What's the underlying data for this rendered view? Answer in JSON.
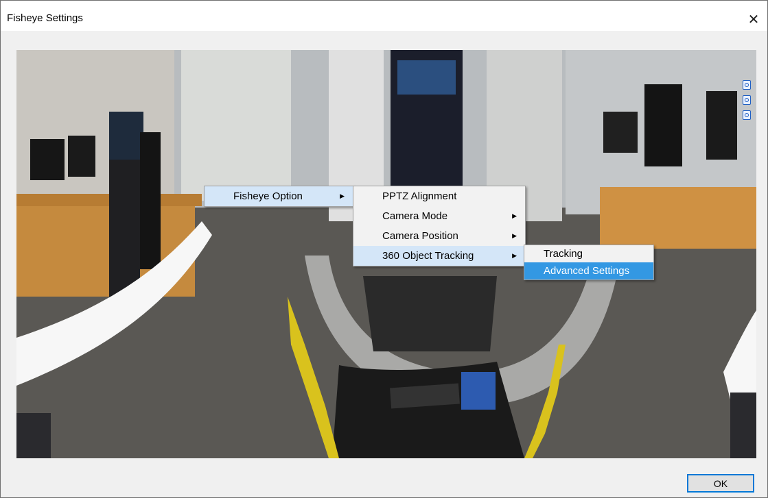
{
  "window": {
    "title": "Fisheye Settings",
    "close_label": "✕"
  },
  "context_menu": {
    "level1": [
      {
        "label": "Fisheye Option",
        "has_submenu": true
      }
    ],
    "level2": [
      {
        "label": "PPTZ Alignment",
        "has_submenu": false
      },
      {
        "label": "Camera Mode",
        "has_submenu": true
      },
      {
        "label": "Camera Position",
        "has_submenu": true
      },
      {
        "label": "360 Object Tracking",
        "has_submenu": true
      }
    ],
    "level3": [
      {
        "label": "Tracking",
        "has_submenu": false
      },
      {
        "label": "Advanced Settings",
        "has_submenu": false
      }
    ],
    "submenu_arrow": "▶"
  },
  "footer": {
    "ok_label": "OK"
  },
  "icons": [
    "close-icon",
    "zoom-in-icon",
    "zoom-out-icon",
    "fit-screen-icon",
    "submenu-arrow-icon"
  ],
  "colors": {
    "highlight": "#3398e3",
    "active": "#d4e6f8",
    "ok_border": "#0078d7"
  }
}
